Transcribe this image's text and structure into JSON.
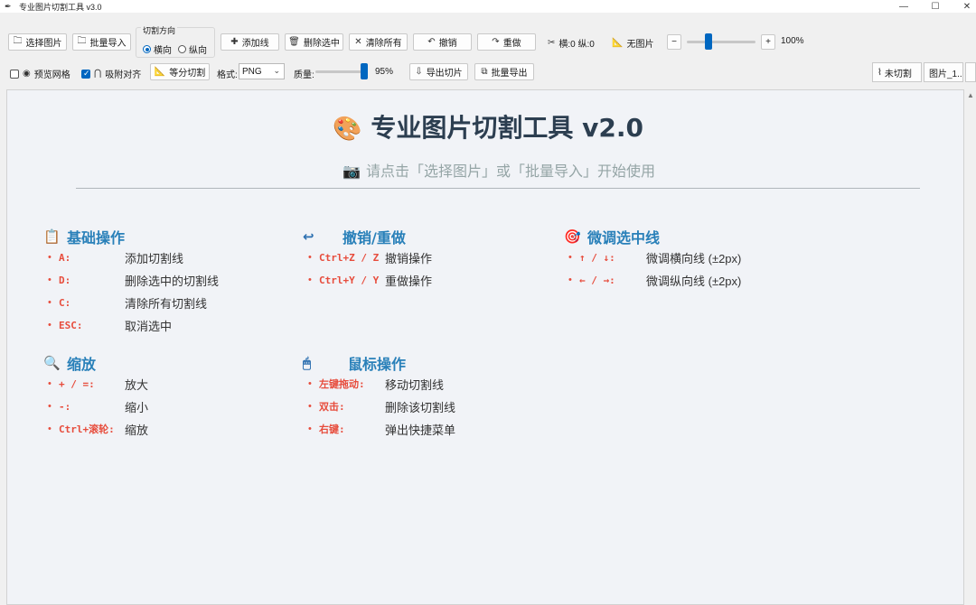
{
  "window": {
    "title": "专业图片切割工具 v3.0",
    "icon": "feather-icon",
    "controls": [
      "minimize",
      "maximize",
      "close"
    ]
  },
  "toolbar": {
    "select_image": "选择图片",
    "batch_import": "批量导入",
    "direction_group": {
      "title": "切割方向",
      "options": [
        "横向",
        "纵向"
      ],
      "selected": "横向"
    },
    "add_line": "添加线",
    "delete_selected": "删除选中",
    "clear_all": "清除所有",
    "undo": "撤销",
    "redo": "重做",
    "counts": "横:0 纵:0",
    "image_status": "无图片",
    "zoom_minus": "−",
    "zoom_plus": "+",
    "zoom_value": "100%",
    "zoom_level": 0.4,
    "preview_grid": "预览网格",
    "preview_grid_checked": false,
    "snap_align": "吸附对齐",
    "snap_align_checked": true,
    "equal_split": "等分切割",
    "format_label": "格式:",
    "format_value": "PNG",
    "quality_label": "质量:",
    "quality_value": "95%",
    "quality_level": 0.95,
    "export_slices": "导出切片",
    "batch_export": "批量导出"
  },
  "tabs": [
    {
      "label": "未切割"
    },
    {
      "label": "图片_1..."
    }
  ],
  "welcome": {
    "title": "专业图片切割工具 v2.0",
    "subtitle": "请点击「选择图片」或「批量导入」开始使用"
  },
  "sections": {
    "basic": {
      "title": "基础操作",
      "items": [
        {
          "key": "A:",
          "desc": "添加切割线"
        },
        {
          "key": "D:",
          "desc": "删除选中的切割线"
        },
        {
          "key": "C:",
          "desc": "清除所有切割线"
        },
        {
          "key": "ESC:",
          "desc": "取消选中"
        }
      ]
    },
    "undo_redo": {
      "title": "撤销/重做",
      "items": [
        {
          "key": "Ctrl+Z / Z",
          "desc": "撤销操作"
        },
        {
          "key": "Ctrl+Y / Y",
          "desc": "重做操作"
        }
      ]
    },
    "fine_tune": {
      "title": "微调选中线",
      "items": [
        {
          "key": "↑ / ↓:",
          "desc": "微调横向线 (±2px)"
        },
        {
          "key": "← / →:",
          "desc": "微调纵向线 (±2px)"
        }
      ]
    },
    "zoom": {
      "title": "缩放",
      "items": [
        {
          "key": "+ / =:",
          "desc": "放大"
        },
        {
          "key": "-:",
          "desc": "缩小"
        },
        {
          "key": "Ctrl+滚轮:",
          "desc": "缩放"
        }
      ]
    },
    "mouse": {
      "title": "鼠标操作",
      "items": [
        {
          "key": "左键拖动:",
          "desc": "移动切割线"
        },
        {
          "key": "双击:",
          "desc": "删除该切割线"
        },
        {
          "key": "右键:",
          "desc": "弹出快捷菜单"
        }
      ]
    }
  }
}
